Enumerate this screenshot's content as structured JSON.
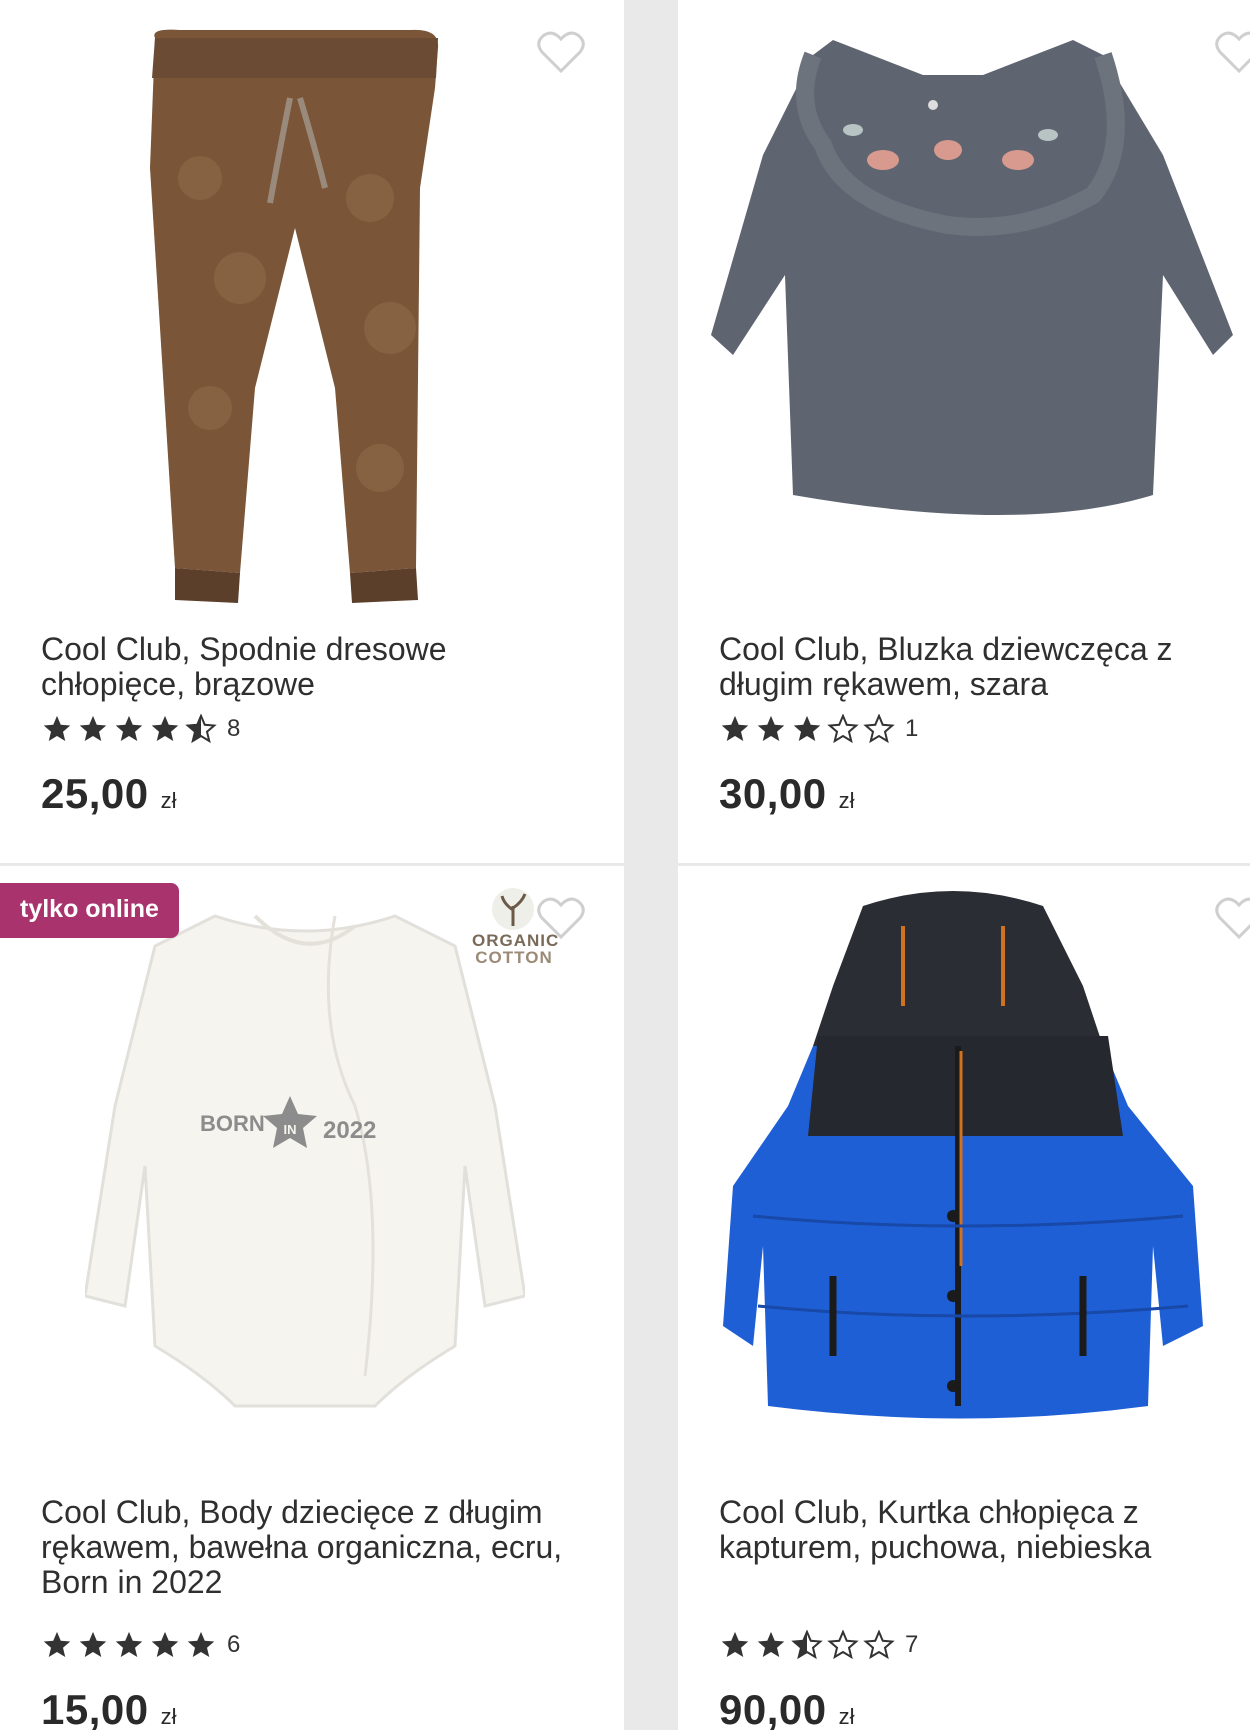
{
  "products": [
    {
      "title": "Cool Club, Spodnie dresowe chłopięce, brązowe",
      "rating_value": 4.5,
      "rating_count": "8",
      "price": "25,00",
      "currency": "zł",
      "image_icon": "brown-fleece-pants"
    },
    {
      "title": "Cool Club, Bluzka dziewczęca z długim rękawem, szara",
      "rating_value": 3,
      "rating_count": "1",
      "price": "30,00",
      "currency": "zł",
      "image_icon": "grey-ruffle-blouse"
    },
    {
      "title": "Cool Club, Body dziecięce z długim rękawem, bawełna organiczna, ecru, Born in 2022",
      "rating_value": 5,
      "rating_count": "6",
      "price": "15,00",
      "currency": "zł",
      "badge": "tylko online",
      "organic_label": [
        "ORGANIC",
        "COTTON"
      ],
      "print_text": [
        "BORN",
        "IN",
        "2022"
      ],
      "image_icon": "white-baby-bodysuit"
    },
    {
      "title": "Cool Club, Kurtka chłopięca z kapturem, puchowa, niebieska",
      "rating_value": 2.5,
      "rating_count": "7",
      "price": "90,00",
      "currency": "zł",
      "image_icon": "blue-puffer-jacket"
    }
  ],
  "colors": {
    "badge": "#a8336d",
    "star": "#333333",
    "heart_outline": "#cfcfcf",
    "background": "#e9e9e9"
  }
}
